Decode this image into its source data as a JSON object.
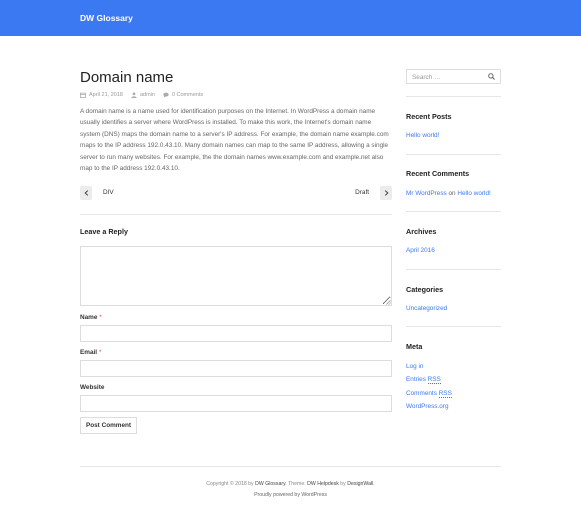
{
  "site": {
    "title": "DW Glossary"
  },
  "post": {
    "title": "Domain name",
    "date": "April 21, 2018",
    "author": "admin",
    "comments": "0 Comments",
    "content": "A domain name is a name used for identification purposes on the Internet. In WordPress a domain name usually identifies a server where WordPress is installed. To make this work, the Internet's domain name system (DNS) maps the domain name to a server's IP address. For example, the domain name example.com maps to the IP address 192.0.43.10. Many domain names can map to the same IP address, allowing a single server to run many websites. For example, the the domain names www.example.com and example.net also map to the IP address 192.0.43.10."
  },
  "post_nav": {
    "prev_label": "DIV",
    "next_label": "Draft"
  },
  "reply_form": {
    "title": "Leave a Reply",
    "name_label": "Name",
    "email_label": "Email",
    "website_label": "Website",
    "required_mark": "*",
    "submit_label": "Post Comment"
  },
  "sidebar": {
    "search_placeholder": "Search …",
    "recent_posts": {
      "title": "Recent Posts",
      "items": [
        "Hello world!"
      ]
    },
    "recent_comments": {
      "title": "Recent Comments",
      "author": "Mr WordPress",
      "on": "on",
      "post": "Hello world!"
    },
    "archives": {
      "title": "Archives",
      "items": [
        "April 2016"
      ]
    },
    "categories": {
      "title": "Categories",
      "items": [
        "Uncategorized"
      ]
    },
    "meta": {
      "title": "Meta",
      "login": "Log in",
      "entries_prefix": "Entries",
      "comments_prefix": "Comments",
      "rss": "RSS",
      "wordpress_org": "WordPress.org"
    }
  },
  "footer": {
    "copyright_prefix": "Copyright © 2018 by",
    "site_link": "DW Glossary",
    "theme_text": ". Theme:",
    "theme_link": "DW Helpdesk",
    "by_text": "by",
    "author_link": "DesignWall",
    "end": ".",
    "powered": "Proudly powered by WordPress"
  },
  "colors": {
    "header": "#3b79f3",
    "link": "#3b79f3"
  },
  "icons": {
    "date": "calendar-icon",
    "author": "user-icon",
    "comments": "comment-icon",
    "search": "search-icon"
  }
}
